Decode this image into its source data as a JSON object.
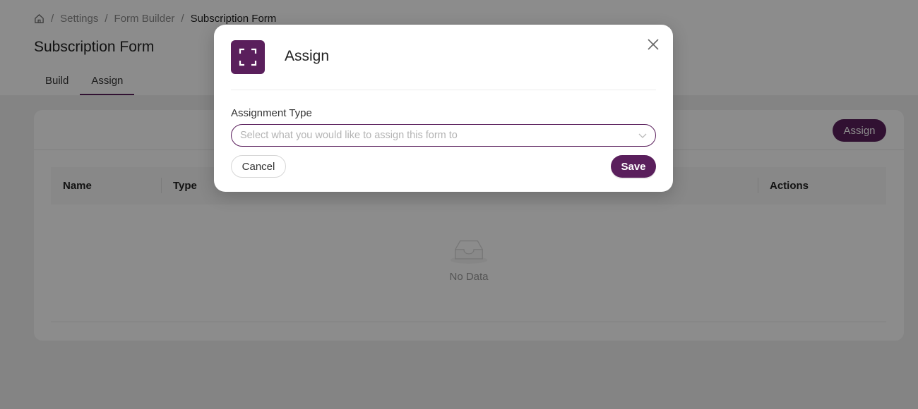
{
  "breadcrumb": {
    "home_icon": "home-icon",
    "items": [
      "Settings",
      "Form Builder",
      "Subscription Form"
    ],
    "separator": "/"
  },
  "page": {
    "title": "Subscription Form",
    "tabs": [
      {
        "label": "Build",
        "active": false
      },
      {
        "label": "Assign",
        "active": true
      }
    ]
  },
  "card": {
    "assign_label": "Assign",
    "table": {
      "columns": [
        "Name",
        "Type",
        "Actions"
      ]
    },
    "empty": {
      "icon": "inbox-icon",
      "text": "No Data"
    }
  },
  "modal": {
    "icon": "expand-icon",
    "title": "Assign",
    "close_icon": "close-icon",
    "field_label": "Assignment Type",
    "select_placeholder": "Select what you would like to assign this form to",
    "cancel_label": "Cancel",
    "save_label": "Save"
  },
  "colors": {
    "brand": "#5a1f5c",
    "overlay": "rgba(0,0,0,0.45)"
  }
}
